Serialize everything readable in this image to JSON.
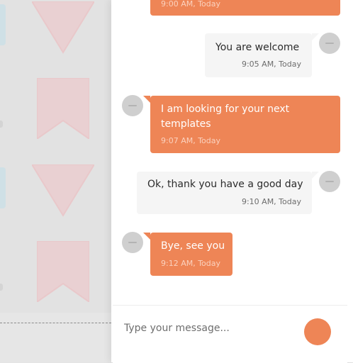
{
  "chat": {
    "messages": [
      {
        "side": "in",
        "text_lines": [
          ""
        ],
        "time": "9:00 AM, Today"
      },
      {
        "side": "out",
        "text_lines": [
          "You are welcome"
        ],
        "time": "9:05 AM, Today"
      },
      {
        "side": "in",
        "text_lines": [
          "I am looking for your next",
          "templates"
        ],
        "time": "9:07 AM, Today"
      },
      {
        "side": "out",
        "text_lines": [
          "Ok, thank you have a good day"
        ],
        "time": "9:10 AM, Today"
      },
      {
        "side": "in",
        "text_lines": [
          "Bye, see you"
        ],
        "time": "9:12 AM, Today"
      }
    ]
  },
  "composer": {
    "placeholder": "Type your message..."
  },
  "colors": {
    "accent": "#ee8556",
    "outgoing_bubble": "#f5f5f5",
    "avatar": "#cfcfcf",
    "background_pink_shapes": "#f0b8bd"
  },
  "icons": {
    "avatar": "user-avatar-placeholder",
    "send": "send-icon"
  }
}
